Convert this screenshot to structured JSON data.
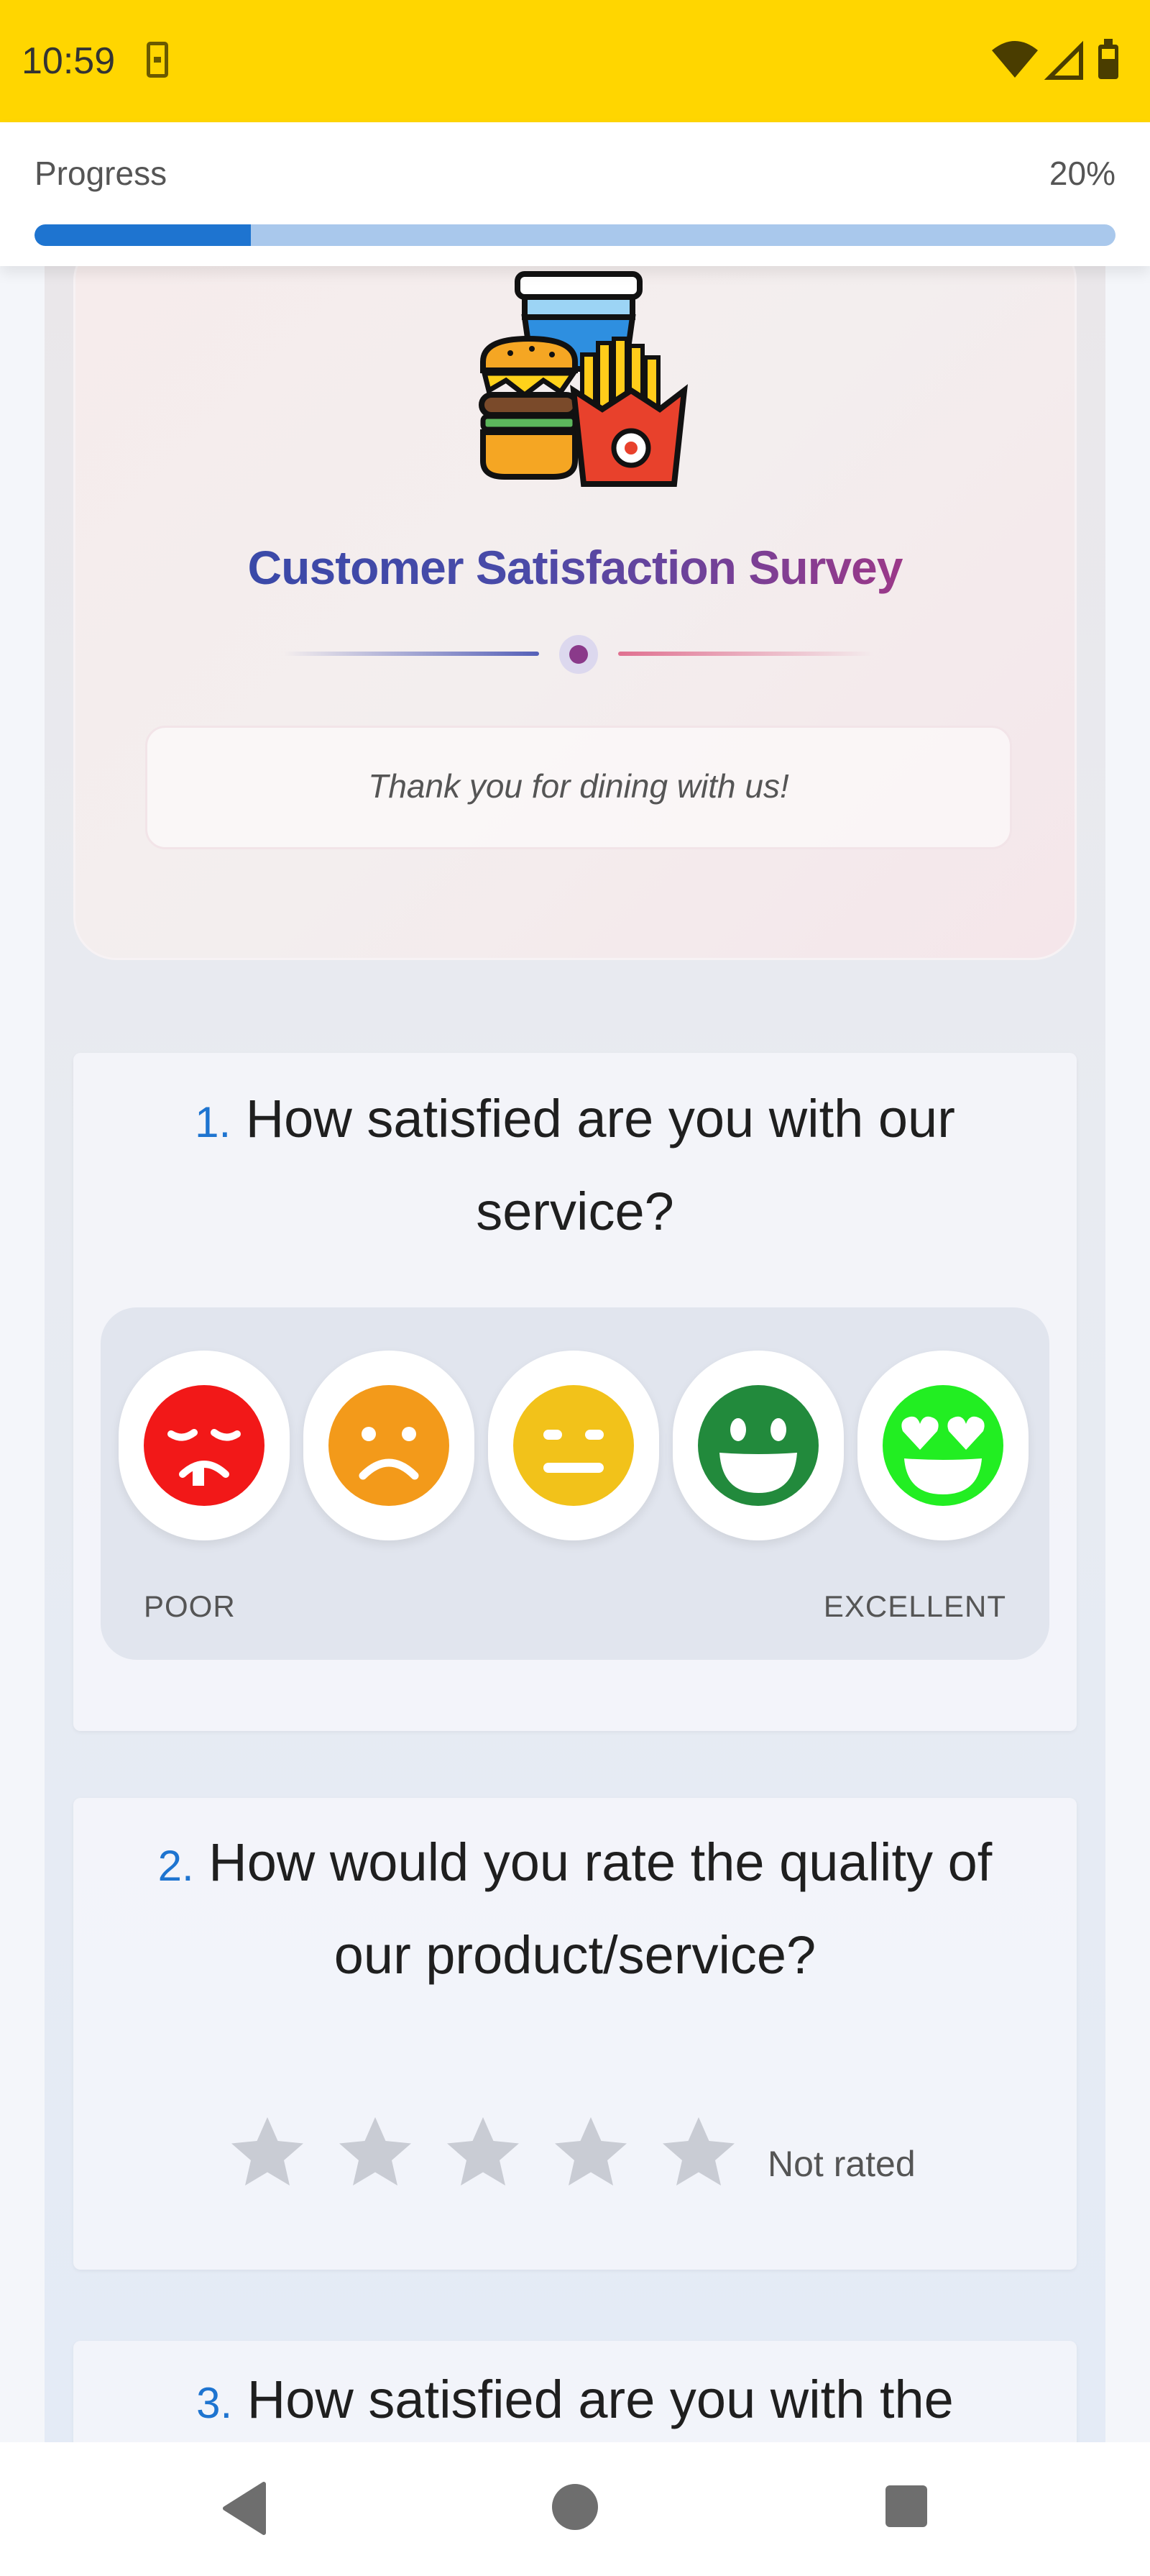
{
  "status_bar": {
    "time": "10:59"
  },
  "progress": {
    "label": "Progress",
    "value_text": "20%",
    "fraction": 0.2
  },
  "header": {
    "title": "Customer Satisfaction Survey",
    "subtitle": "Thank you for dining with us!",
    "logo_icon": "food-combo-icon"
  },
  "questions": [
    {
      "number": "1.",
      "text": "How satisfied are you with our service?",
      "type": "emoji-scale",
      "options": [
        {
          "icon": "very-sad-face-icon",
          "color": "#f21818"
        },
        {
          "icon": "sad-face-icon",
          "color": "#f39a1a"
        },
        {
          "icon": "neutral-face-icon",
          "color": "#f2c21a"
        },
        {
          "icon": "happy-face-icon",
          "color": "#228a3c"
        },
        {
          "icon": "heart-eyes-face-icon",
          "color": "#22ee22"
        }
      ],
      "scale_low": "POOR",
      "scale_high": "EXCELLENT"
    },
    {
      "number": "2.",
      "text": "How would you rate the quality of our product/service?",
      "type": "stars",
      "max": 5,
      "rating": 0,
      "rating_text": "Not rated"
    },
    {
      "number": "3.",
      "text": "How satisfied are you with the"
    }
  ],
  "colors": {
    "status_bar": "#ffd600",
    "accent": "#1e74d0",
    "star_empty": "#c9ccd4"
  }
}
